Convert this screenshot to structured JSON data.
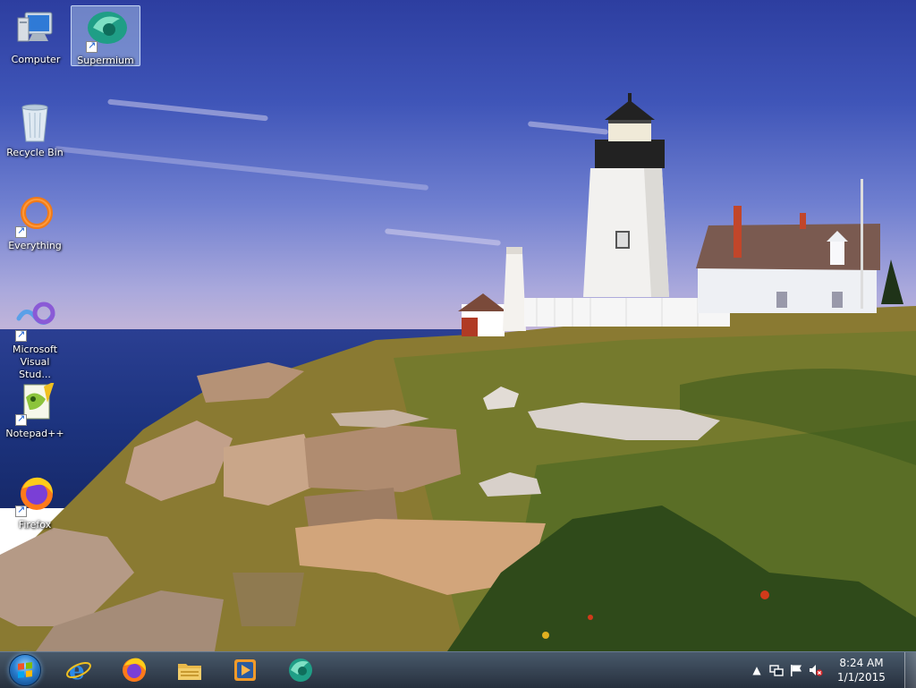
{
  "desktop": {
    "icons": [
      {
        "label": "Computer",
        "icon": "computer-icon",
        "selected": false
      },
      {
        "label": "Supermium",
        "icon": "supermium-icon",
        "selected": true
      },
      {
        "label": "Recycle Bin",
        "icon": "recycle-bin-icon",
        "selected": false
      },
      {
        "label": "Everything",
        "icon": "everything-icon",
        "selected": false
      },
      {
        "label": "Microsoft Visual Stud...",
        "icon": "visual-studio-icon",
        "selected": false
      },
      {
        "label": "Notepad++",
        "icon": "notepad-plus-plus-icon",
        "selected": false
      },
      {
        "label": "Firefox",
        "icon": "firefox-icon",
        "selected": false
      }
    ]
  },
  "taskbar": {
    "start": {
      "icon": "windows-start-orb-icon"
    },
    "pinned": [
      {
        "name": "Internet Explorer",
        "icon": "internet-explorer-icon"
      },
      {
        "name": "Firefox",
        "icon": "firefox-icon"
      },
      {
        "name": "Windows Explorer",
        "icon": "file-explorer-icon"
      },
      {
        "name": "Windows Media Player",
        "icon": "media-player-icon"
      },
      {
        "name": "Supermium",
        "icon": "supermium-icon"
      }
    ],
    "tray": {
      "icons": [
        "show-hidden-icons-chevron-icon",
        "network-icon",
        "action-center-flag-icon",
        "volume-muted-icon"
      ],
      "time": "8:24 AM",
      "date": "1/1/2015"
    }
  },
  "colors": {
    "accent": "#2a7fd0",
    "taskbar": "#1c2a3a",
    "label_text": "#ffffff"
  }
}
